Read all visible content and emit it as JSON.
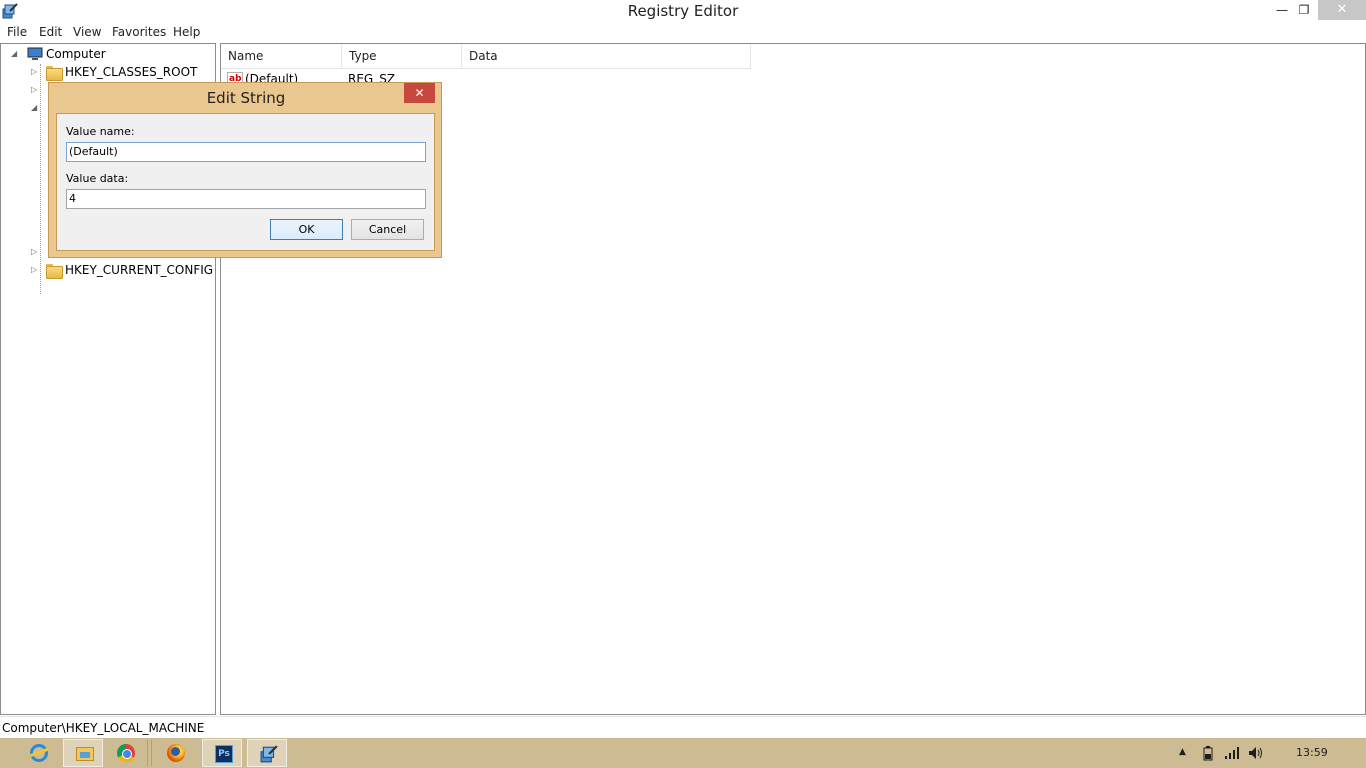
{
  "window": {
    "title": "Registry Editor",
    "minimize_glyph": "—",
    "restore_glyph": "❐",
    "close_glyph": "✕"
  },
  "menu": [
    "File",
    "Edit",
    "View",
    "Favorites",
    "Help"
  ],
  "tree": {
    "root": "Computer",
    "items": [
      "HKEY_CLASSES_ROOT",
      "HKEY_CURRENT_CONFIG"
    ]
  },
  "list": {
    "columns": [
      "Name",
      "Type",
      "Data"
    ],
    "rows": [
      {
        "name": "(Default)",
        "type": "REG_SZ",
        "data": ""
      }
    ],
    "icon_text": "ab"
  },
  "status": {
    "path": "Computer\\HKEY_LOCAL_MACHINE"
  },
  "dialog": {
    "title": "Edit String",
    "close_glyph": "✕",
    "value_name_label": "Value name:",
    "value_name": "(Default)",
    "value_data_label": "Value data:",
    "value_data": "4",
    "ok_label": "OK",
    "cancel_label": "Cancel"
  },
  "taskbar": {
    "ps_text": "Ps",
    "clock": "13:59"
  },
  "colors": {
    "taskbar": "#cdbb93",
    "dialog_frame": "#e9c78f",
    "close_red": "#c7483f"
  }
}
